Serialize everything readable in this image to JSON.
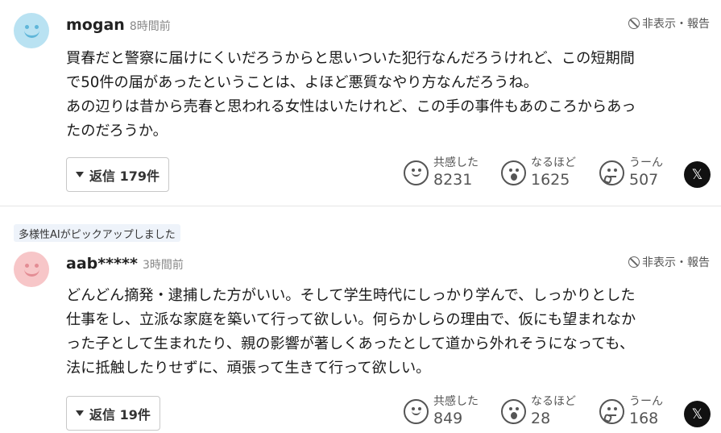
{
  "comments": [
    {
      "username": "mogan",
      "time": "8時間前",
      "hide_report": "非表示・報告",
      "lines": [
        "買春だと警察に届けにくいだろうからと思いついた犯行なんだろうけれど、この短期間",
        "で50件の届があったということは、よほど悪質なやり方なんだろうね。",
        "あの辺りは昔から売春と思われる女性はいたけれど、この手の事件もあのころからあっ",
        "たのだろうか。"
      ],
      "reply_label": "返信 179件",
      "reactions": {
        "empathy": {
          "label": "共感した",
          "count": "8231"
        },
        "naruhodo": {
          "label": "なるほど",
          "count": "1625"
        },
        "uun": {
          "label": "うーん",
          "count": "507"
        }
      },
      "share_icon": "x-icon"
    },
    {
      "badge": "多様性AIがピックアップしました",
      "username": "aab*****",
      "time": "3時間前",
      "hide_report": "非表示・報告",
      "lines": [
        "どんどん摘発・逮捕した方がいい。そして学生時代にしっかり学んで、しっかりとした",
        "仕事をし、立派な家庭を築いて行って欲しい。何らかしらの理由で、仮にも望まれなか",
        "った子として生まれたり、親の影響が著しくあったとして道から外れそうになっても、",
        "法に抵触したりせずに、頑張って生きて行って欲しい。"
      ],
      "reply_label": "返信 19件",
      "reactions": {
        "empathy": {
          "label": "共感した",
          "count": "849"
        },
        "naruhodo": {
          "label": "なるほど",
          "count": "28"
        },
        "uun": {
          "label": "うーん",
          "count": "168"
        }
      },
      "share_icon": "x-icon"
    }
  ],
  "x_glyph": "𝕏"
}
